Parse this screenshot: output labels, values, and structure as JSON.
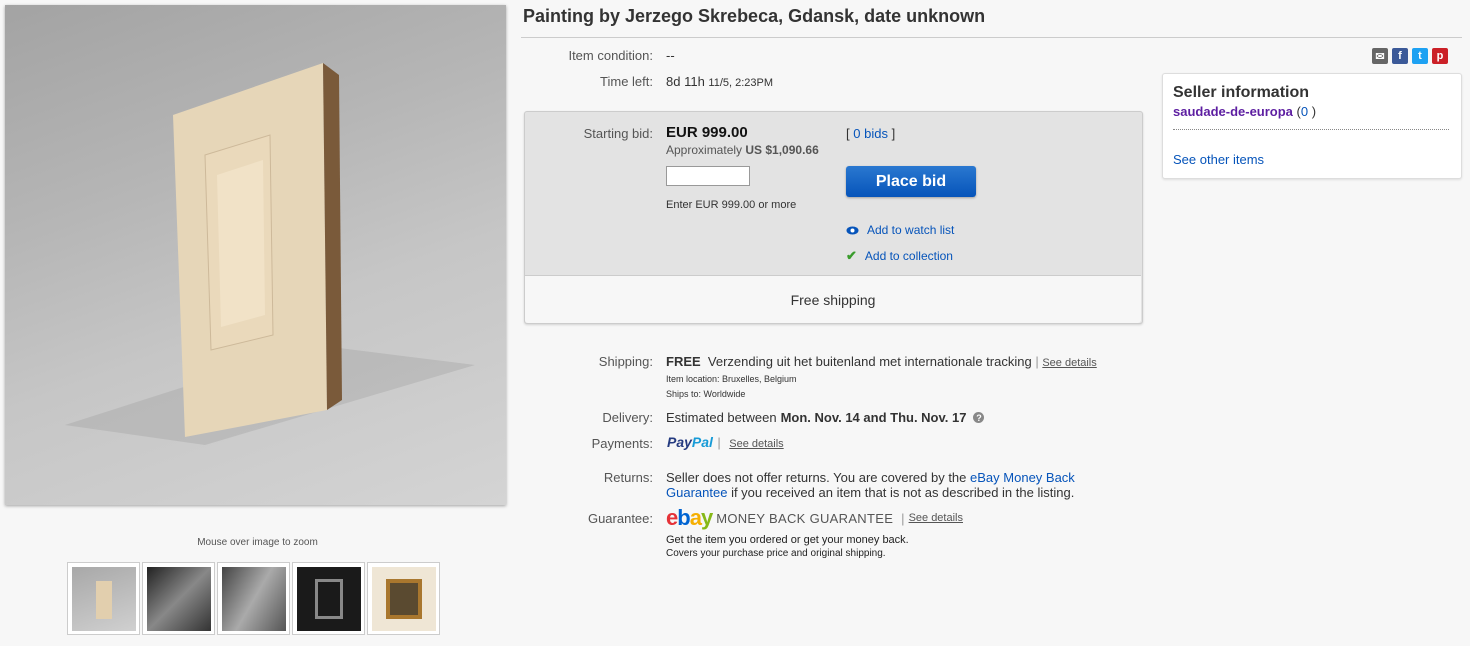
{
  "title": "Painting by Jerzego Skrebeca, Gdansk, date unknown",
  "gallery": {
    "zoom_hint": "Mouse over image to zoom",
    "thumbnails": [
      "thumb-1",
      "thumb-2",
      "thumb-3",
      "thumb-4",
      "thumb-5"
    ]
  },
  "item": {
    "condition_label": "Item condition:",
    "condition_value": "--",
    "time_left_label": "Time left:",
    "time_left_value": "8d 11h",
    "time_left_end": "11/5, 2:23PM"
  },
  "social_icons": [
    "email-icon",
    "facebook-icon",
    "twitter-icon",
    "pinterest-icon"
  ],
  "bid": {
    "starting_label": "Starting bid:",
    "price": "EUR 999.00",
    "approx_prefix": "Approximately",
    "approx_value": "US $1,090.66",
    "bids_open": "[",
    "bids_link": "0 bids",
    "bids_close": "]",
    "input_hint": "Enter EUR 999.00 or more",
    "place_bid": "Place bid",
    "watch": "Add to watch list",
    "collection": "Add to collection",
    "free_shipping": "Free shipping"
  },
  "seller": {
    "heading": "Seller information",
    "name": "saudade-de-europa",
    "feedback_open": "(",
    "feedback_count": "0",
    "feedback_close": ")",
    "see_other": "See other items"
  },
  "details": {
    "shipping_label": "Shipping:",
    "shipping_free": "FREE",
    "shipping_text": "Verzending uit het buitenland met internationale tracking",
    "sep": "|",
    "see_details": "See details",
    "location": "Item location:  Bruxelles, Belgium",
    "ships_to": "Ships to:  Worldwide",
    "delivery_label": "Delivery:",
    "delivery_prefix": "Estimated between",
    "delivery_range": "Mon. Nov. 14 and Thu. Nov. 17",
    "payments_label": "Payments:",
    "paypal_pay": "Pay",
    "paypal_pal": "Pal",
    "returns_label": "Returns:",
    "returns_text1": "Seller does not offer returns. You are covered by the",
    "returns_link1": "eBay Money Back",
    "returns_link2": "Guarantee",
    "returns_text2": "if you received an item that is not as described in the listing.",
    "guarantee_label": "Guarantee:",
    "mbg": "MONEY BACK GUARANTEE",
    "guarantee_line1": "Get the item you ordered or get your money back.",
    "guarantee_line2": "Covers your purchase price and original shipping."
  },
  "colors": {
    "link": "#0654ba",
    "seller_name": "#5d1ea1",
    "button": "#0654ba",
    "facebook": "#3b5998",
    "twitter": "#1da1f2",
    "pinterest": "#cb2027",
    "email": "#666666"
  }
}
